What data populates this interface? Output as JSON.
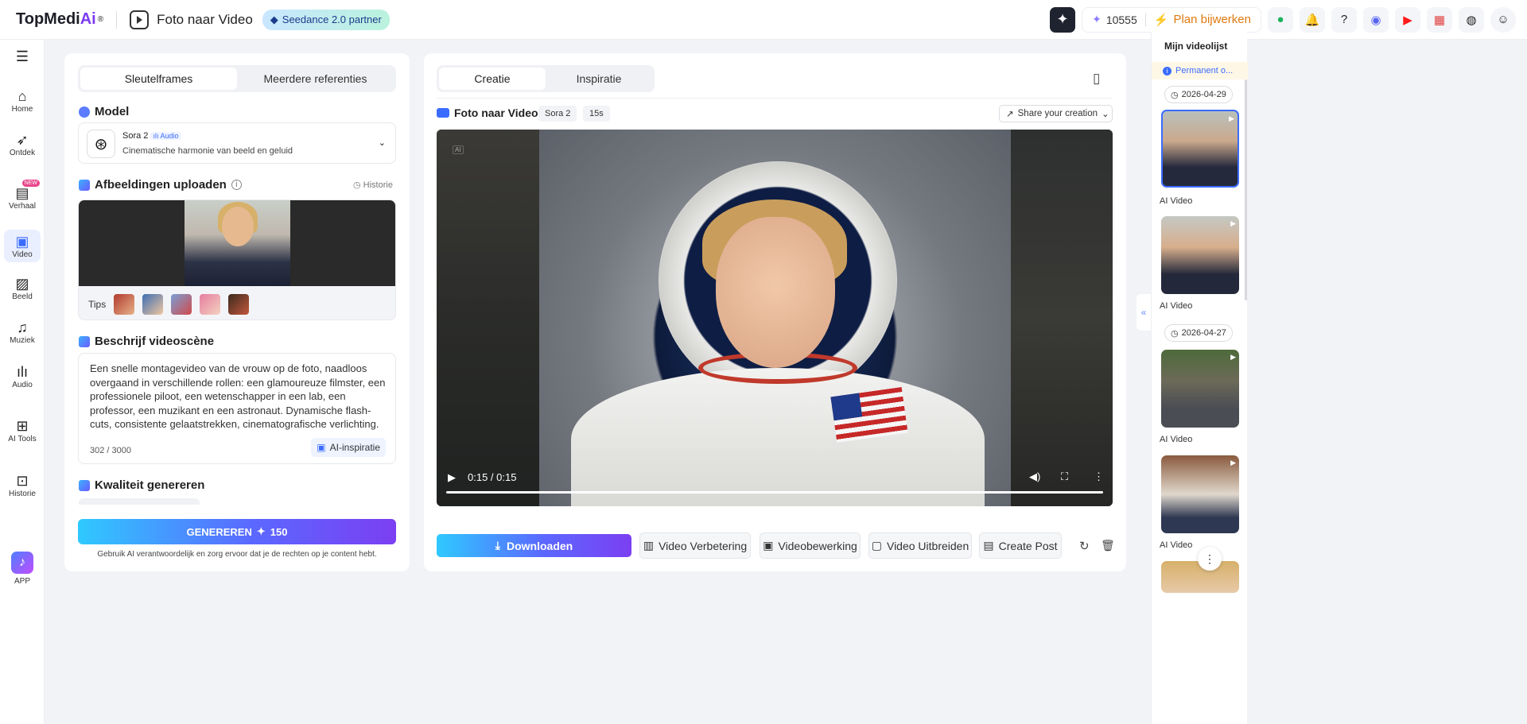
{
  "header": {
    "logo_main": "TopMedi",
    "logo_ai": "Ai",
    "logo_reg": "®",
    "page_title": "Foto naar Video",
    "partner_badge": "Seedance 2.0 partner",
    "credits": "10555",
    "upgrade": "Plan bijwerken",
    "icons": [
      "sparkle-icon",
      "credit-star-icon",
      "lightning-icon",
      "discount-icon",
      "bell-icon",
      "help-icon",
      "discord-icon",
      "youtube-icon",
      "calendar-icon",
      "language-icon",
      "avatar"
    ]
  },
  "sidebar": {
    "items": [
      {
        "label": "Home",
        "icon": "home-icon"
      },
      {
        "label": "Ontdek",
        "icon": "compass-icon"
      },
      {
        "label": "Verhaal",
        "icon": "story-icon",
        "badge": "NEW"
      },
      {
        "label": "Video",
        "icon": "video-icon",
        "active": true
      },
      {
        "label": "Beeld",
        "icon": "image-icon"
      },
      {
        "label": "Muziek",
        "icon": "music-icon"
      },
      {
        "label": "Audio",
        "icon": "audio-icon"
      },
      {
        "label": "AI Tools",
        "icon": "tools-icon"
      },
      {
        "label": "Historie",
        "icon": "history-icon"
      },
      {
        "label": "APP",
        "icon": "app-icon"
      }
    ]
  },
  "left_panel": {
    "tabs": [
      "Sleutelframes",
      "Meerdere referenties"
    ],
    "model_title": "Model",
    "model_name": "Sora 2",
    "model_audio_badge": "Audio",
    "model_desc": "Cinematische harmonie van beeld en geluid",
    "upload_title": "Afbeeldingen uploaden",
    "history_link": "Historie",
    "tips_label": "Tips",
    "scene_title": "Beschrijf videoscène",
    "prompt": "Een snelle montagevideo van de vrouw op de foto, naadloos overgaand in verschillende rollen: een glamoureuze filmster, een professionele piloot, een wetenschapper in een lab, een professor, een muzikant en een astronaut. Dynamische flash-cuts, consistente gelaatstrekken, cinematografische verlichting.",
    "counter": "302 / 3000",
    "ai_inspiration": "AI-inspiratie",
    "quality_title": "Kwaliteit genereren",
    "generate_label": "GENEREREN",
    "generate_cost": "150",
    "disclaimer": "Gebruik AI verantwoordelijk en zorg ervoor dat je de rechten op je content hebt."
  },
  "center_panel": {
    "tabs": [
      "Creatie",
      "Inspiratie"
    ],
    "section_title": "Foto naar Video",
    "chips": [
      "Sora 2",
      "15s"
    ],
    "share": "Share your creation",
    "player": {
      "time": "0:15 / 0:15",
      "ai_mark": "AI",
      "progress": 1.0
    },
    "download": "Downloaden",
    "actions": [
      "Video Verbetering",
      "Videobewerking",
      "Video Uitbreiden",
      "Create Post"
    ]
  },
  "right_panel": {
    "title": "Mijn videolijst",
    "notice": "Permanent o...",
    "dates": [
      "2026-04-29",
      "2026-04-27"
    ],
    "video_label": "AI Video"
  }
}
